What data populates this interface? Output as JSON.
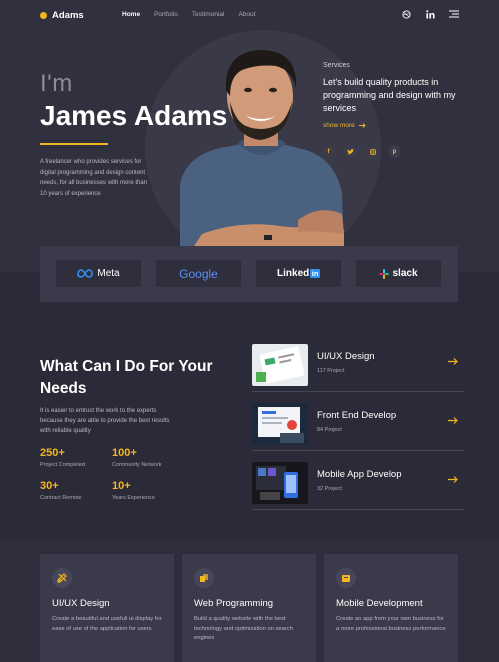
{
  "nav": {
    "logo": "Adams",
    "links": [
      "Home",
      "Portfolio",
      "Testimonial",
      "About"
    ]
  },
  "hero": {
    "greeting": "I'm",
    "name": "James Adams",
    "intro": "A freelancer who provides services for digital programming and design content needs, for all businesses with more than 10 years of experience",
    "services_label": "Services",
    "services_title": "Let's build quality products in programming and design with my services",
    "show_more": "show more"
  },
  "brands": [
    "Meta",
    "Google",
    "Linked",
    "slack"
  ],
  "brands_in_badge": "in",
  "what": {
    "title": "What Can I Do For Your Needs",
    "desc": "It is easier to entrust the work to the experts because they are able to provide the best results with reliable quality",
    "stats": [
      {
        "num": "250+",
        "label": "Project Completed"
      },
      {
        "num": "100+",
        "label": "Community Network"
      },
      {
        "num": "30+",
        "label": "Contract Remote"
      },
      {
        "num": "10+",
        "label": "Years Experience"
      }
    ]
  },
  "projects": [
    {
      "title": "UI/UX Design",
      "sub": "117 Project"
    },
    {
      "title": "Front End Develop",
      "sub": "84 Project"
    },
    {
      "title": "Mobile App Develop",
      "sub": "32 Project"
    }
  ],
  "cards": [
    {
      "title": "UI/UX Design",
      "desc": "Create a beautiful and usefull ui display for ease of use of the application for users"
    },
    {
      "title": "Web Programming",
      "desc": "Build a quality website with the best technology and optimization on search engines"
    },
    {
      "title": "Mobile Development",
      "desc": "Create an app from your own business for a more professional business performance"
    }
  ],
  "colors": {
    "accent": "#f5b623",
    "bg": "#2b2a38",
    "panel": "#3b3a4a"
  }
}
